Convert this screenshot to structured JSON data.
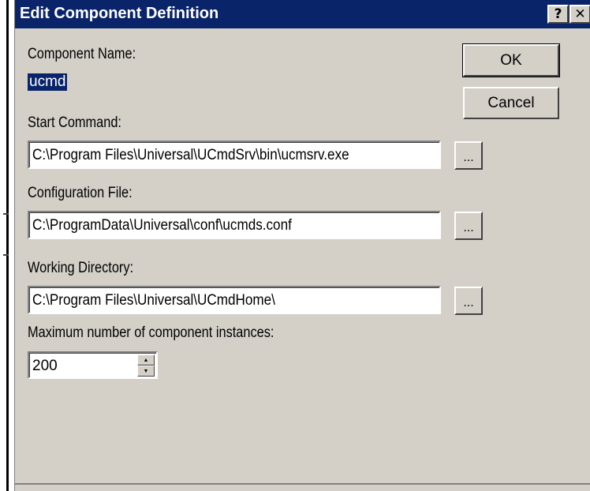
{
  "dialog": {
    "title": "Edit Component Definition",
    "help_glyph": "?",
    "close_glyph": "✕"
  },
  "fields": {
    "component_name_label": "Component Name:",
    "component_name_value": "ucmd",
    "start_command_label": "Start Command:",
    "start_command_value": "C:\\Program Files\\Universal\\UCmdSrv\\bin\\ucmsrv.exe",
    "config_file_label": "Configuration File:",
    "config_file_value": "C:\\ProgramData\\Universal\\conf\\ucmds.conf",
    "working_dir_label": "Working Directory:",
    "working_dir_value": "C:\\Program Files\\Universal\\UCmdHome\\",
    "max_instances_label": "Maximum number of component instances:",
    "max_instances_value": "200"
  },
  "buttons": {
    "ok": "OK",
    "cancel": "Cancel",
    "browse": "..."
  },
  "colors": {
    "titlebar": "#0a246a",
    "face": "#d4d0c8"
  }
}
